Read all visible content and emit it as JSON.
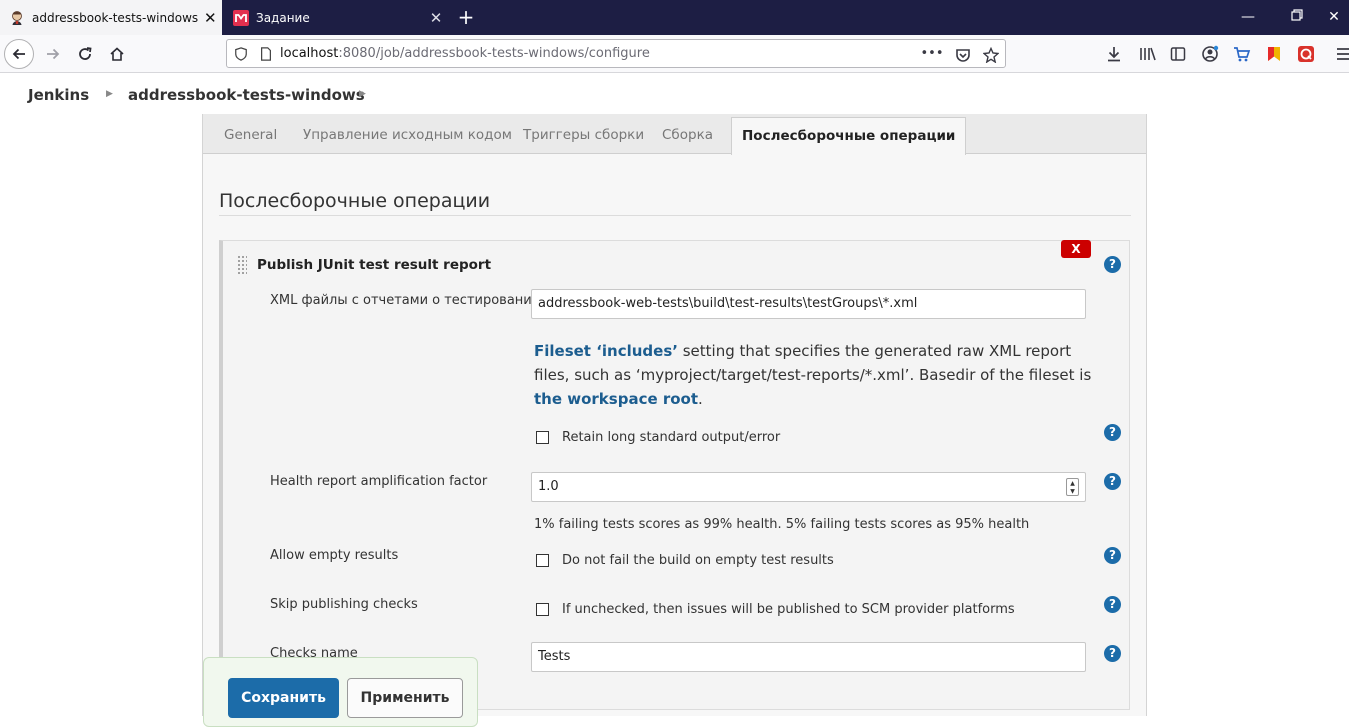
{
  "browser": {
    "tabs": [
      {
        "title": "addressbook-tests-windows Co",
        "favicon": "jenkins-butler-icon",
        "active": true
      },
      {
        "title": "Задание",
        "favicon": "m-square-icon",
        "active": false
      }
    ],
    "url_host": "localhost",
    "url_rest": ":8080/job/addressbook-tests-windows/configure",
    "page_actions": "•••"
  },
  "breadcrumb": {
    "items": [
      "Jenkins",
      "addressbook-tests-windows"
    ]
  },
  "config_tabs": [
    "General",
    "Управление исходным кодом",
    "Триггеры сборки",
    "Сборка",
    "Послесборочные операции"
  ],
  "section_title": "Послесборочные операции",
  "publisher": {
    "title": "Publish JUnit test result report",
    "delete_label": "X",
    "help_label": "?",
    "xml_label": "XML файлы с отчетами о тестировании",
    "xml_value": "addressbook-web-tests\\build\\test-results\\testGroups\\*.xml",
    "desc_link1": "Fileset ‘includes’",
    "desc_text1": " setting that specifies the generated raw XML report files, such as ‘myproject/target/test-reports/*.xml’. Basedir of the fileset is ",
    "desc_link2": "the workspace root",
    "desc_text2": ".",
    "retain_label": "Retain long standard output/error",
    "health_label": "Health report amplification factor",
    "health_value": "1.0",
    "health_hint": "1% failing tests scores as 99% health. 5% failing tests scores as 95% health",
    "allow_empty_label": "Allow empty results",
    "allow_empty_checkbox": "Do not fail the build on empty test results",
    "skip_label": "Skip publishing checks",
    "skip_checkbox": "If unchecked, then issues will be published to SCM provider platforms",
    "checks_name_label": "Checks name",
    "checks_name_value": "Tests"
  },
  "buttons": {
    "save": "Сохранить",
    "apply": "Применить"
  },
  "colors": {
    "tabstrip": "#1d1e44",
    "primary_button": "#1c6ca9",
    "delete_button": "#cc0000",
    "link": "#1c5d8f"
  }
}
